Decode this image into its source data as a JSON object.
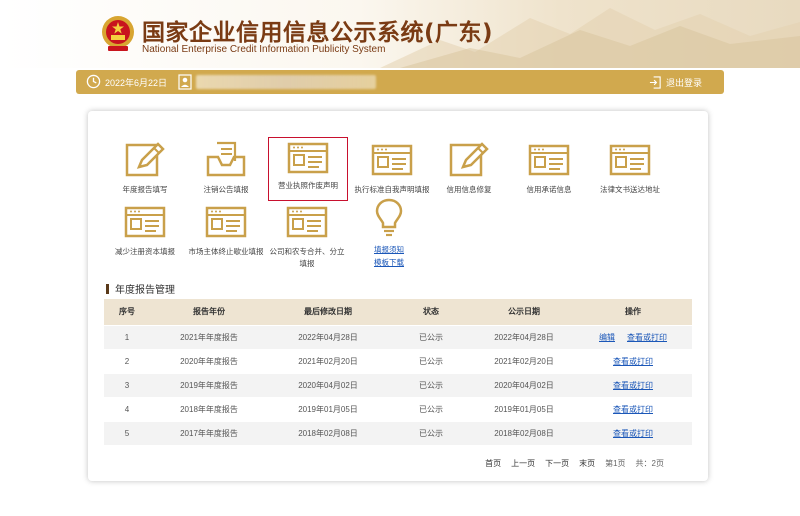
{
  "header": {
    "title_cn": "国家企业信用信息公示系统(广东)",
    "title_en": "National Enterprise Credit Information Publicity System"
  },
  "topbar": {
    "date": "2022年6月22日",
    "logout": "退出登录",
    "bg_color": "#d1a94e"
  },
  "tiles": [
    {
      "label": "年度报告填写",
      "icon": "edit-doc-icon"
    },
    {
      "label": "注销公告填报",
      "icon": "inbox-doc-icon"
    },
    {
      "label": "营业执照作废声明",
      "icon": "license-card-icon"
    },
    {
      "label": "执行标准自我声明填报",
      "icon": "license-card-icon"
    },
    {
      "label": "信用信息修复",
      "icon": "edit-doc-icon"
    },
    {
      "label": "信用承诺信息",
      "icon": "license-card-icon"
    },
    {
      "label": "法律文书送达地址",
      "icon": "license-card-icon"
    },
    {
      "label": "减少注册资本填报",
      "icon": "license-card-icon"
    },
    {
      "label": "市场主体终止歇业填报",
      "icon": "license-card-icon"
    },
    {
      "label": "公司和农专合并、分立填报",
      "icon": "license-card-icon"
    }
  ],
  "hints": {
    "icon": "lightbulb-icon",
    "fill_notice": "填报须知",
    "template_download": "模板下载"
  },
  "section": {
    "title": "年度报告管理"
  },
  "table": {
    "headers": [
      "序号",
      "报告年份",
      "最后修改日期",
      "状态",
      "公示日期",
      "操作"
    ],
    "rows": [
      {
        "no": "1",
        "year": "2021年年度报告",
        "modified": "2022年04月28日",
        "status": "已公示",
        "published": "2022年04月28日",
        "edit": "编辑",
        "view": "查看或打印"
      },
      {
        "no": "2",
        "year": "2020年年度报告",
        "modified": "2021年02月20日",
        "status": "已公示",
        "published": "2021年02月20日",
        "edit": "",
        "view": "查看或打印"
      },
      {
        "no": "3",
        "year": "2019年年度报告",
        "modified": "2020年04月02日",
        "status": "已公示",
        "published": "2020年04月02日",
        "edit": "",
        "view": "查看或打印"
      },
      {
        "no": "4",
        "year": "2018年年度报告",
        "modified": "2019年01月05日",
        "status": "已公示",
        "published": "2019年01月05日",
        "edit": "",
        "view": "查看或打印"
      },
      {
        "no": "5",
        "year": "2017年年度报告",
        "modified": "2018年02月08日",
        "status": "已公示",
        "published": "2018年02月08日",
        "edit": "",
        "view": "查看或打印"
      }
    ]
  },
  "pager": {
    "first": "首页",
    "prev": "上一页",
    "next": "下一页",
    "last": "末页",
    "current": "第1页",
    "total": "共：2页"
  },
  "colors": {
    "gold": "#d1a94e",
    "icon_gold": "#c9a04a",
    "link": "#1b57b8",
    "selected_border": "#c8102e"
  }
}
